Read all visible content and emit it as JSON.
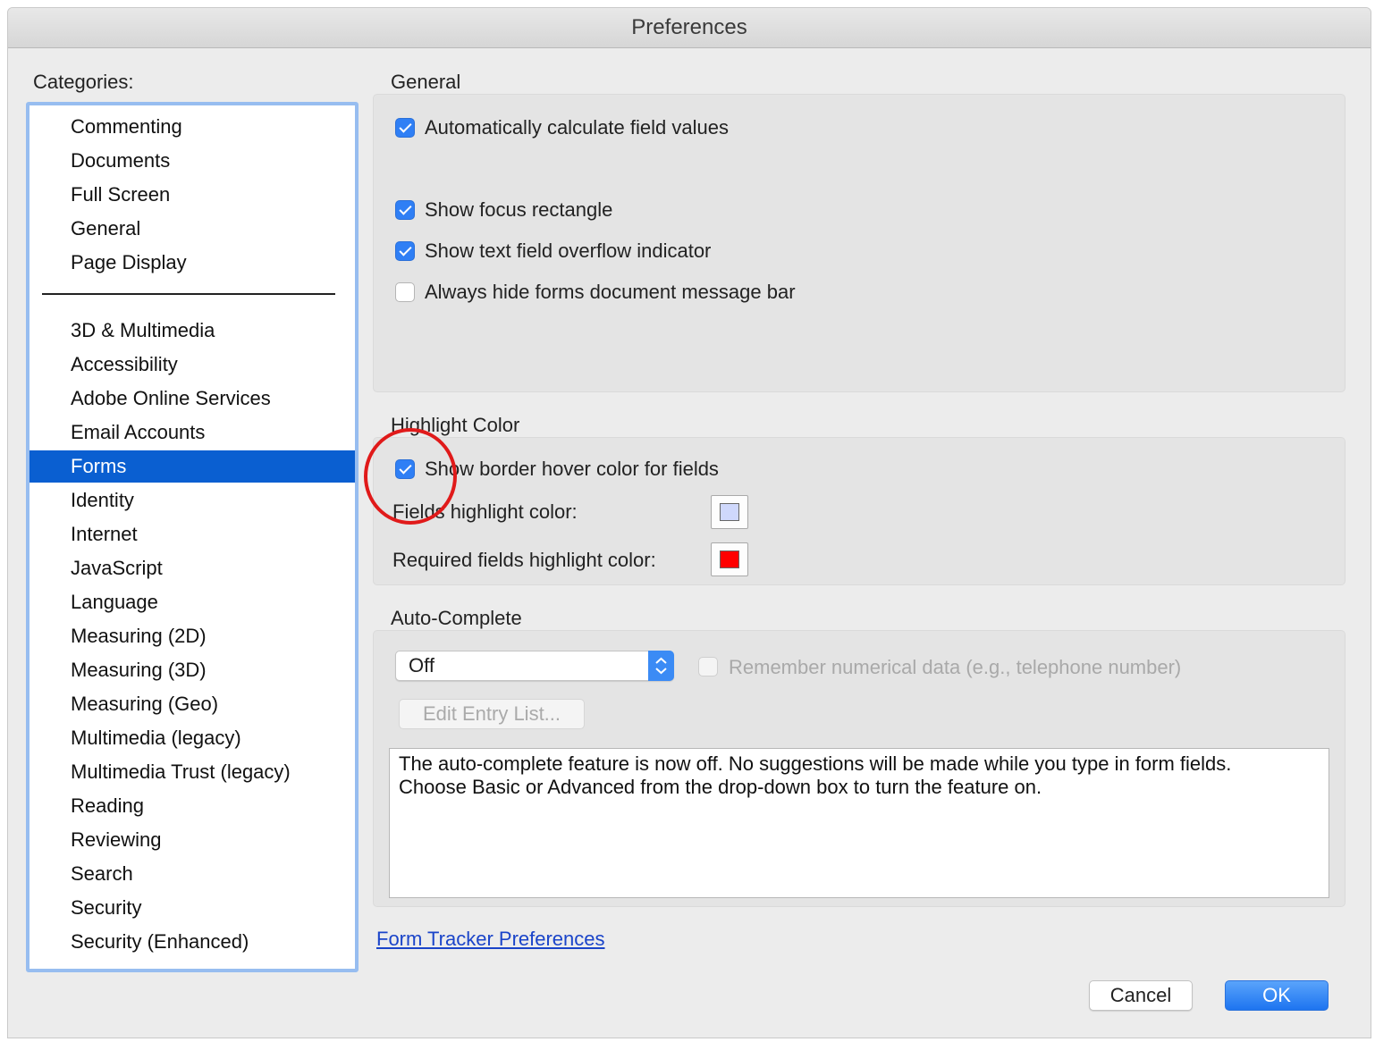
{
  "window": {
    "title": "Preferences"
  },
  "categories": {
    "label": "Categories:",
    "group1": [
      "Commenting",
      "Documents",
      "Full Screen",
      "General",
      "Page Display"
    ],
    "group2": [
      "3D & Multimedia",
      "Accessibility",
      "Adobe Online Services",
      "Email Accounts",
      "Forms",
      "Identity",
      "Internet",
      "JavaScript",
      "Language",
      "Measuring (2D)",
      "Measuring (3D)",
      "Measuring (Geo)",
      "Multimedia (legacy)",
      "Multimedia Trust (legacy)",
      "Reading",
      "Reviewing",
      "Search",
      "Security",
      "Security (Enhanced)"
    ],
    "selected": "Forms"
  },
  "general": {
    "title": "General",
    "auto_calc": {
      "label": "Automatically calculate field values",
      "checked": true
    },
    "focus_rect": {
      "label": "Show focus rectangle",
      "checked": true
    },
    "overflow": {
      "label": "Show text field overflow indicator",
      "checked": true
    },
    "hide_msg_bar": {
      "label": "Always hide forms document message bar",
      "checked": false
    }
  },
  "highlight": {
    "title": "Highlight Color",
    "border_hover": {
      "label": "Show border hover color for fields",
      "checked": true
    },
    "fields_label": "Fields highlight color:",
    "fields_color": "#cfd8fc",
    "required_label": "Required fields highlight color:",
    "required_color": "#ff0000"
  },
  "autocomplete": {
    "title": "Auto-Complete",
    "select_value": "Off",
    "remember": {
      "label": "Remember numerical data (e.g., telephone number)",
      "checked": false,
      "enabled": false
    },
    "edit_button": "Edit Entry List...",
    "description_line1": "The auto-complete feature is now off. No suggestions will be made while you type in form fields.",
    "description_line2": "Choose Basic or Advanced from the drop-down box to turn the feature on."
  },
  "form_tracker_link": "Form Tracker Preferences",
  "buttons": {
    "cancel": "Cancel",
    "ok": "OK"
  },
  "annotation": {
    "circle_color": "#e01a1a"
  }
}
